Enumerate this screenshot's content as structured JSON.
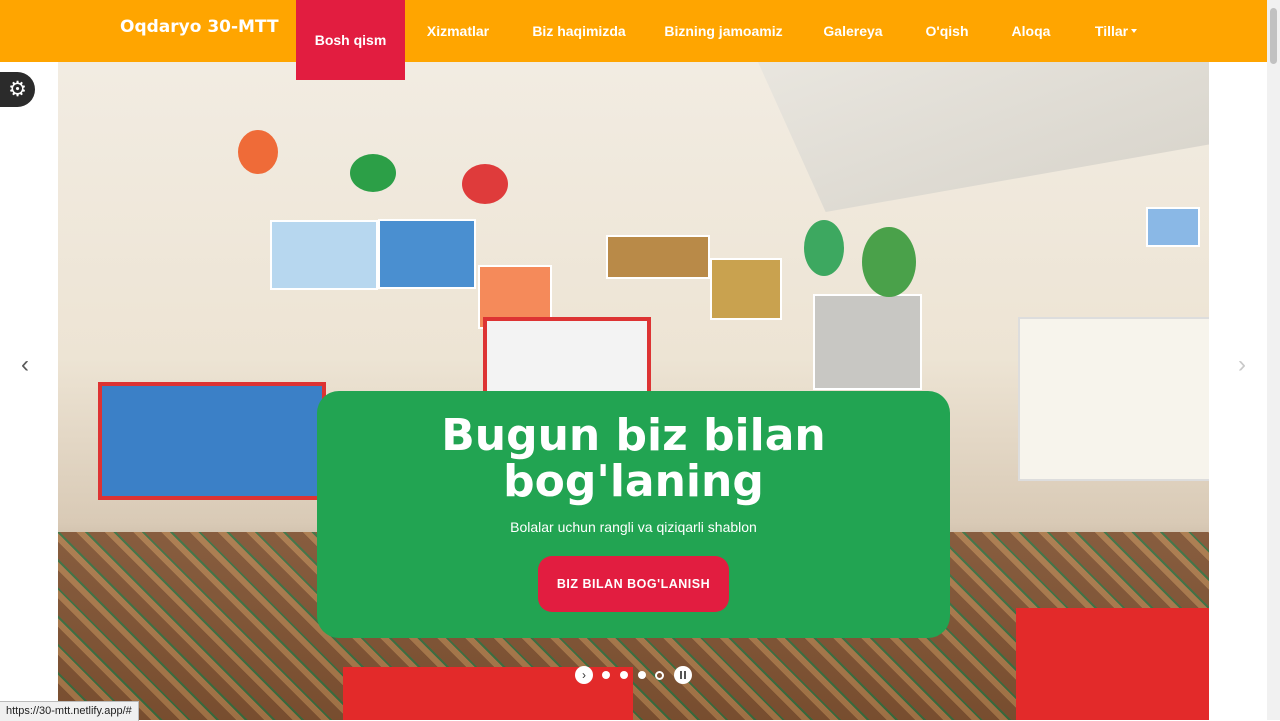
{
  "brand": "Oqdaryo 30-MTT",
  "nav": {
    "items": [
      {
        "label": "Bosh qism"
      },
      {
        "label": "Xizmatlar"
      },
      {
        "label": "Biz haqimizda"
      },
      {
        "label": "Bizning jamoamiz"
      },
      {
        "label": "Galereya"
      },
      {
        "label": "O'qish"
      },
      {
        "label": "Aloqa"
      },
      {
        "label": "Tillar"
      }
    ]
  },
  "hero": {
    "title": "Bugun biz bilan bog'laning",
    "subtitle": "Bolalar uchun rangli va qiziqarli shablon",
    "button": "BIZ BILAN BOG'LANISH"
  },
  "carousel": {
    "prev": "‹",
    "next": "›",
    "indicator_arrow": "›"
  },
  "settings_icon": "⚙",
  "status_url": "https://30-mtt.netlify.app/#",
  "colors": {
    "nav_bg": "#ffa500",
    "active_nav": "#e21d40",
    "caption_bg": "#22a452",
    "button_bg": "#e21d40"
  }
}
